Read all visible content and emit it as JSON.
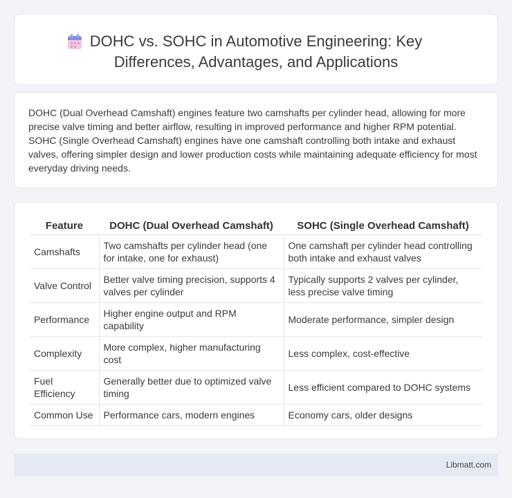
{
  "header": {
    "title": "DOHC vs. SOHC in Automotive Engineering: Key Differences, Advantages, and Applications",
    "icon": "calendar-icon"
  },
  "intro": {
    "text": "DOHC (Dual Overhead Camshaft) engines feature two camshafts per cylinder head, allowing for more precise valve timing and better airflow, resulting in improved performance and higher RPM potential. SOHC (Single Overhead Camshaft) engines have one camshaft controlling both intake and exhaust valves, offering simpler design and lower production costs while maintaining adequate efficiency for most everyday driving needs."
  },
  "table": {
    "headers": [
      "Feature",
      "DOHC (Dual Overhead Camshaft)",
      "SOHC (Single Overhead Camshaft)"
    ],
    "rows": [
      [
        "Camshafts",
        "Two camshafts per cylinder head (one for intake, one for exhaust)",
        "One camshaft per cylinder head controlling both intake and exhaust valves"
      ],
      [
        "Valve Control",
        "Better valve timing precision, supports 4 valves per cylinder",
        "Typically supports 2 valves per cylinder, less precise valve timing"
      ],
      [
        "Performance",
        "Higher engine output and RPM capability",
        "Moderate performance, simpler design"
      ],
      [
        "Complexity",
        "More complex, higher manufacturing cost",
        "Less complex, cost-effective"
      ],
      [
        "Fuel Efficiency",
        "Generally better due to optimized valve timing",
        "Less efficient compared to DOHC systems"
      ],
      [
        "Common Use",
        "Performance cars, modern engines",
        "Economy cars, older designs"
      ]
    ]
  },
  "footer": {
    "text": "Libmatt.com"
  }
}
